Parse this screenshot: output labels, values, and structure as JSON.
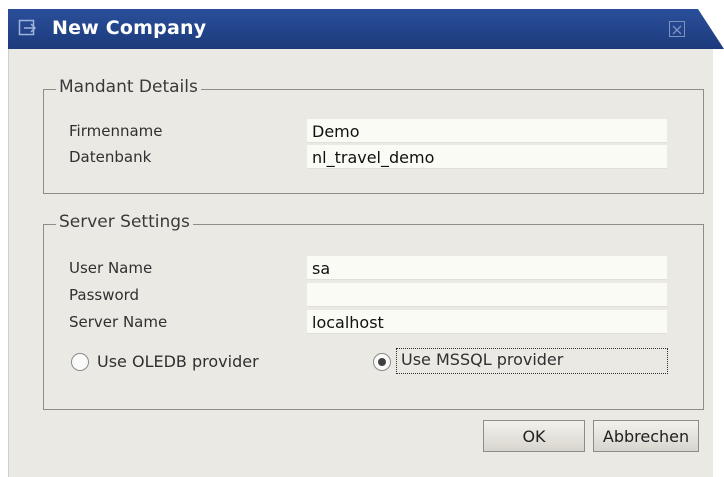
{
  "window": {
    "title": "New Company",
    "icon": "window-menu-icon",
    "close_icon": "close-icon"
  },
  "mandant": {
    "legend": "Mandant Details",
    "fields": [
      {
        "label": "Firmenname",
        "value": "Demo"
      },
      {
        "label": "Datenbank",
        "value": "nl_travel_demo"
      }
    ]
  },
  "server": {
    "legend": "Server Settings",
    "fields": [
      {
        "label": "User Name",
        "value": "sa"
      },
      {
        "label": "Password",
        "value": ""
      },
      {
        "label": "Server Name",
        "value": "localhost"
      }
    ],
    "options": [
      {
        "label": "Use OLEDB provider",
        "selected": false
      },
      {
        "label": "Use MSSQL provider",
        "selected": true
      }
    ]
  },
  "buttons": {
    "ok": "OK",
    "cancel": "Abbrechen"
  }
}
